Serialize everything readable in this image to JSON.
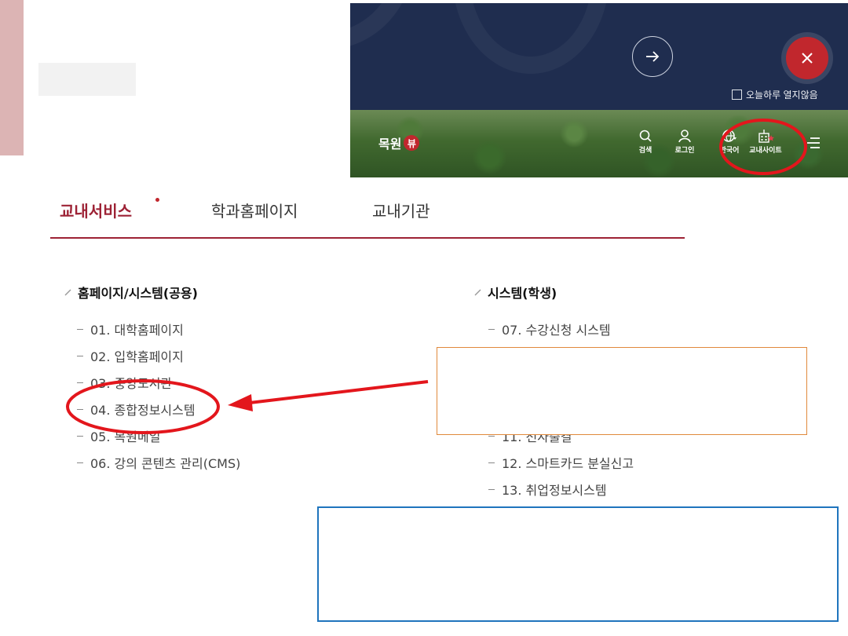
{
  "header": {
    "today_close_label": "오늘하루 열지않음",
    "brand_text": "목원",
    "brand_badge": "뷰",
    "utilities": [
      {
        "label": "검색",
        "icon": "search-icon"
      },
      {
        "label": "로그인",
        "icon": "user-icon"
      },
      {
        "label": "한국어",
        "icon": "globe-icon"
      },
      {
        "label": "교내사이트",
        "icon": "campus-site-icon"
      }
    ]
  },
  "tabs": [
    {
      "label": "교내서비스",
      "active": true
    },
    {
      "label": "학과홈페이지",
      "active": false
    },
    {
      "label": "교내기관",
      "active": false
    }
  ],
  "sections": {
    "left": {
      "title": "홈페이지/시스템(공용)",
      "items": [
        "01. 대학홈페이지",
        "02. 입학홈페이지",
        "03. 중앙도서관",
        "04. 종합정보시스템",
        "05. 목원메일",
        "06. 강의 콘텐츠 관리(CMS)"
      ]
    },
    "right": {
      "title": "시스템(학생)",
      "items": [
        "07. 수강신청 시스템",
        "",
        "",
        "",
        "11. 전자출결",
        "12. 스마트카드 분실신고",
        "13. 취업정보시스템"
      ]
    }
  },
  "colors": {
    "accent": "#9d2235",
    "header_navy": "#1f2d4f",
    "close_red": "#c1272d",
    "annotation_red": "#e3161c",
    "orange_box": "#e0893c",
    "blue_box": "#1f74bd"
  }
}
